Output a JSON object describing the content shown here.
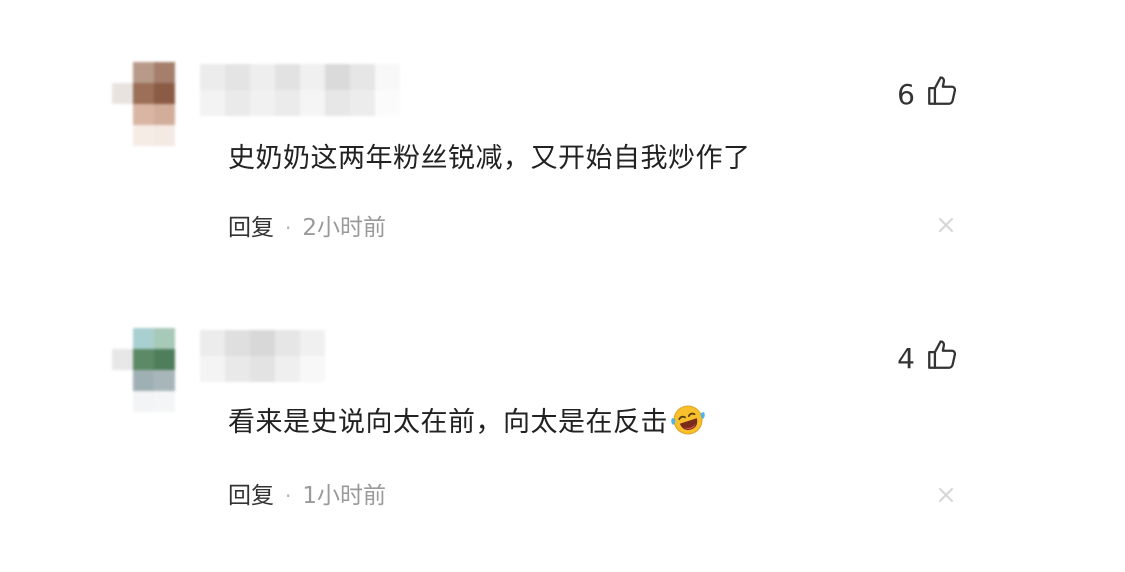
{
  "comments": [
    {
      "content": "史奶奶这两年粉丝锐减，又开始自我炒作了",
      "reply_label": "回复",
      "separator": "·",
      "time": "2小时前",
      "like_count": "6",
      "avatar_icon": "blurred-avatar",
      "username_icon": "blurred-username"
    },
    {
      "content": "看来是史说向太在前，向太是在反击",
      "emoji": "laughing-crying-face",
      "reply_label": "回复",
      "separator": "·",
      "time": "1小时前",
      "like_count": "4",
      "avatar_icon": "blurred-avatar",
      "username_icon": "blurred-username"
    }
  ],
  "icons": {
    "like": "thumbs-up-icon",
    "close": "close-icon"
  },
  "colors": {
    "text": "#222222",
    "meta_time": "#9a9a9a",
    "close_icon": "#d6d6d6"
  }
}
